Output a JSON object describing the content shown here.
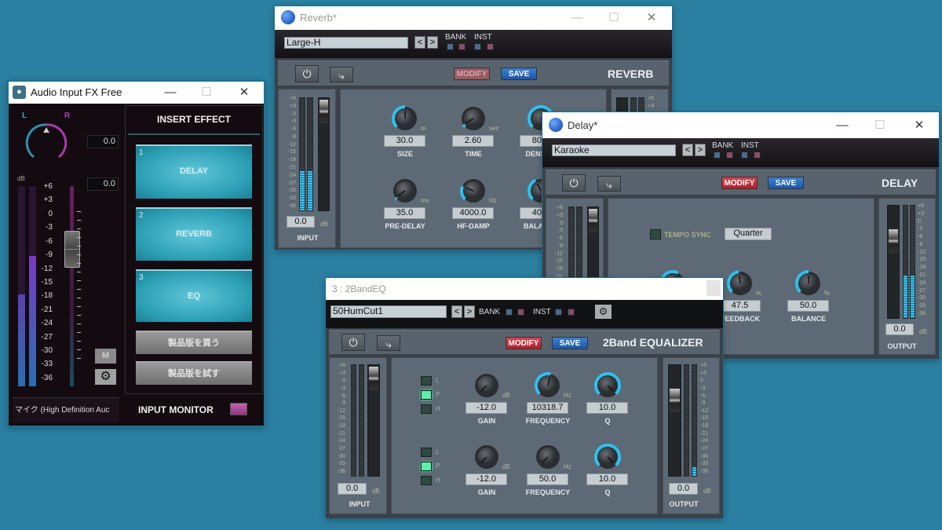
{
  "desktop": {
    "background": "#2b7fa0"
  },
  "db_scale": [
    "+6",
    "+3",
    "0",
    "-3",
    "-6",
    "-9",
    "-12",
    "-15",
    "-18",
    "-21",
    "-24",
    "-27",
    "-30",
    "-33",
    "-36"
  ],
  "colors": {
    "modify_active": "#c8283a",
    "save": "#2a6bc0",
    "slot": "#2a9db2",
    "meter": "#36c3ef"
  },
  "audio_fx": {
    "title": "Audio Input FX Free",
    "pan_l": "L",
    "pan_r": "R",
    "value_top": "0.0",
    "value_gain": "0.0",
    "db_label": "dB",
    "db_scale": [
      "+6",
      "+3",
      "0",
      "-3",
      "-6",
      "-9",
      "-12",
      "-15",
      "-18",
      "-21",
      "-24",
      "-27",
      "-30",
      "-33",
      "-36"
    ],
    "meter_levels": [
      0.46,
      0.65
    ],
    "mute_label": "M",
    "device": "マイク (High Definition Auc",
    "insert_header": "INSERT EFFECT",
    "slots": [
      {
        "num": "1",
        "name": "DELAY"
      },
      {
        "num": "2",
        "name": "REVERB"
      },
      {
        "num": "3",
        "name": "EQ"
      }
    ],
    "buy_button": "製品版を買う",
    "try_button": "製品版を試す",
    "input_monitor": "INPUT MONITOR"
  },
  "reverb": {
    "title": "Reverb*",
    "preset": "Large-H",
    "bank": "BANK",
    "inst": "INST",
    "modify": "MODIFY",
    "save": "SAVE",
    "name": "REVERB",
    "input_value": "0.0",
    "db": "dB",
    "input_label": "INPUT",
    "meter_levels": [
      0.35,
      0.35
    ],
    "knobs": [
      {
        "label": "SIZE",
        "value": "30.0",
        "unit": "m",
        "level": 0.5
      },
      {
        "label": "TIME",
        "value": "2.60",
        "unit": "sec",
        "level": 0.05
      },
      {
        "label": "DENSITY",
        "value": "80.0",
        "unit": "",
        "level": 0.8
      },
      {
        "label": "PRE-DELAY",
        "value": "35.0",
        "unit": "ms",
        "level": 0.03
      },
      {
        "label": "HF-DAMP",
        "value": "4000.0",
        "unit": "Hz",
        "level": 0.25
      },
      {
        "label": "BALANCE",
        "value": "40.0",
        "unit": "",
        "level": 0.4
      }
    ]
  },
  "delay": {
    "title": "Delay*",
    "preset": "Karaoke",
    "bank": "BANK",
    "inst": "INST",
    "modify": "MODIFY",
    "save": "SAVE",
    "name": "DELAY",
    "tempo_sync": "TEMPO SYNC",
    "sync_value": "Quarter",
    "output_value": "0.0",
    "db": "dB",
    "output_label": "OUTPUT",
    "meter_levels": [
      0.35,
      0.35
    ],
    "out_meter_levels": [
      0.38,
      0.38
    ],
    "knobs": [
      {
        "label": "",
        "value": "",
        "unit": "",
        "level": 0.6
      },
      {
        "label": "FEEDBACK",
        "value": "47.5",
        "unit": "%",
        "level": 0.475
      },
      {
        "label": "BALANCE",
        "value": "50.0",
        "unit": "%",
        "level": 0.5
      }
    ]
  },
  "eq": {
    "title": "3 : 2BandEQ",
    "preset": "50HumCut1",
    "bank": "BANK",
    "inst": "INST",
    "modify": "MODIFY",
    "save": "SAVE",
    "name": "2Band EQUALIZER",
    "input_value": "0.0",
    "output_value": "0.0",
    "db": "dB",
    "input_label": "INPUT",
    "output_label": "OUTPUT",
    "meter_levels": [
      0,
      0
    ],
    "out_meter_levels": [
      0,
      0.08
    ],
    "filter_types": [
      "L",
      "P",
      "H"
    ],
    "bands": [
      {
        "selected": "P",
        "knobs": [
          {
            "label": "GAIN",
            "value": "-12.0",
            "unit": "dB",
            "level": 0
          },
          {
            "label": "FREQUENCY",
            "value": "10318.7",
            "unit": "Hz",
            "level": 0.55
          },
          {
            "label": "Q",
            "value": "10.0",
            "unit": "",
            "level": 1
          }
        ]
      },
      {
        "selected": "P",
        "knobs": [
          {
            "label": "GAIN",
            "value": "-12.0",
            "unit": "dB",
            "level": 0
          },
          {
            "label": "FREQUENCY",
            "value": "50.0",
            "unit": "Hz",
            "level": 0
          },
          {
            "label": "Q",
            "value": "10.0",
            "unit": "",
            "level": 1
          }
        ]
      }
    ]
  }
}
